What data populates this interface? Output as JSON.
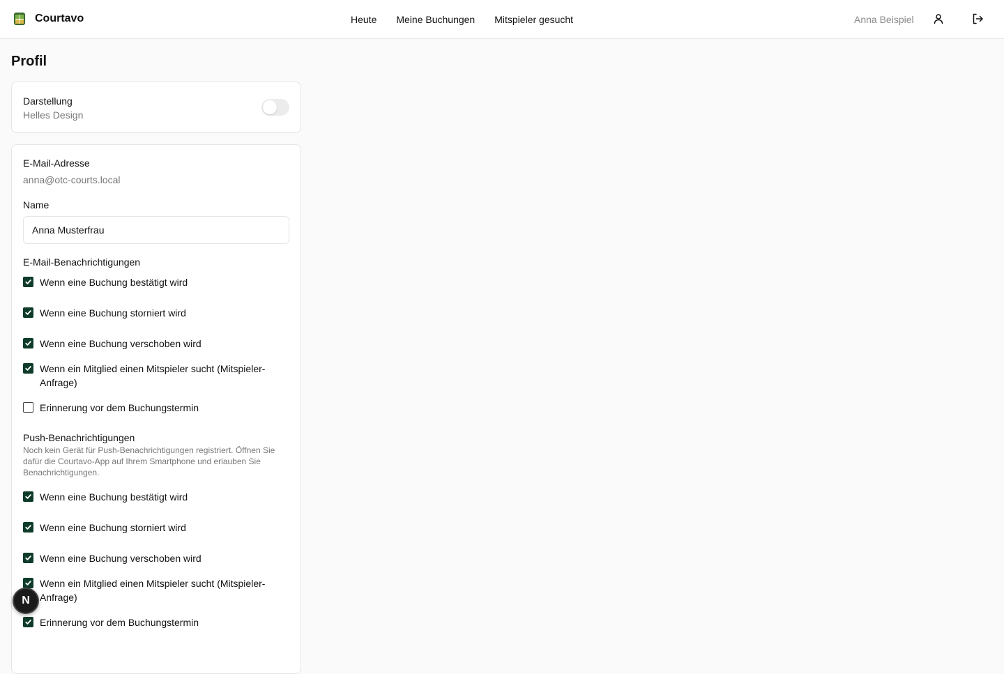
{
  "app": {
    "name": "Courtavo"
  },
  "nav": {
    "items": [
      "Heute",
      "Meine Buchungen",
      "Mitspieler gesucht"
    ]
  },
  "user": {
    "name": "Anna Beispiel"
  },
  "page": {
    "title": "Profil"
  },
  "appearance": {
    "label": "Darstellung",
    "value": "Helles Design",
    "dark_mode_on": false
  },
  "profile": {
    "email_label": "E-Mail-Adresse",
    "email_value": "anna@otc-courts.local",
    "name_label": "Name",
    "name_value": "Anna Musterfrau"
  },
  "email_notifications": {
    "title": "E-Mail-Benachrichtigungen",
    "items": [
      {
        "label": "Wenn eine Buchung bestätigt wird",
        "checked": true
      },
      {
        "label": "Wenn eine Buchung storniert wird",
        "checked": true
      },
      {
        "label": "Wenn eine Buchung verschoben wird",
        "checked": true
      },
      {
        "label": "Wenn ein Mitglied einen Mitspieler sucht (Mitspieler-Anfrage)",
        "checked": true
      },
      {
        "label": "Erinnerung vor dem Buchungstermin",
        "checked": false
      }
    ]
  },
  "push_notifications": {
    "title": "Push-Benachrichtigungen",
    "hint": "Noch kein Gerät für Push-Benachrichtigungen registriert. Öffnen Sie dafür die Courtavo-App auf Ihrem Smartphone und erlauben Sie Benachrichtigungen.",
    "items": [
      {
        "label": "Wenn eine Buchung bestätigt wird",
        "checked": true
      },
      {
        "label": "Wenn eine Buchung storniert wird",
        "checked": true
      },
      {
        "label": "Wenn eine Buchung verschoben wird",
        "checked": true
      },
      {
        "label": "Wenn ein Mitglied einen Mitspieler sucht (Mitspieler-Anfrage)",
        "checked": true
      },
      {
        "label": "Erinnerung vor dem Buchungstermin",
        "checked": true
      }
    ]
  },
  "floating_button": {
    "label": "N"
  },
  "colors": {
    "accent": "#0f3b2a",
    "muted_text": "#777777",
    "border": "#e5e5e5"
  }
}
